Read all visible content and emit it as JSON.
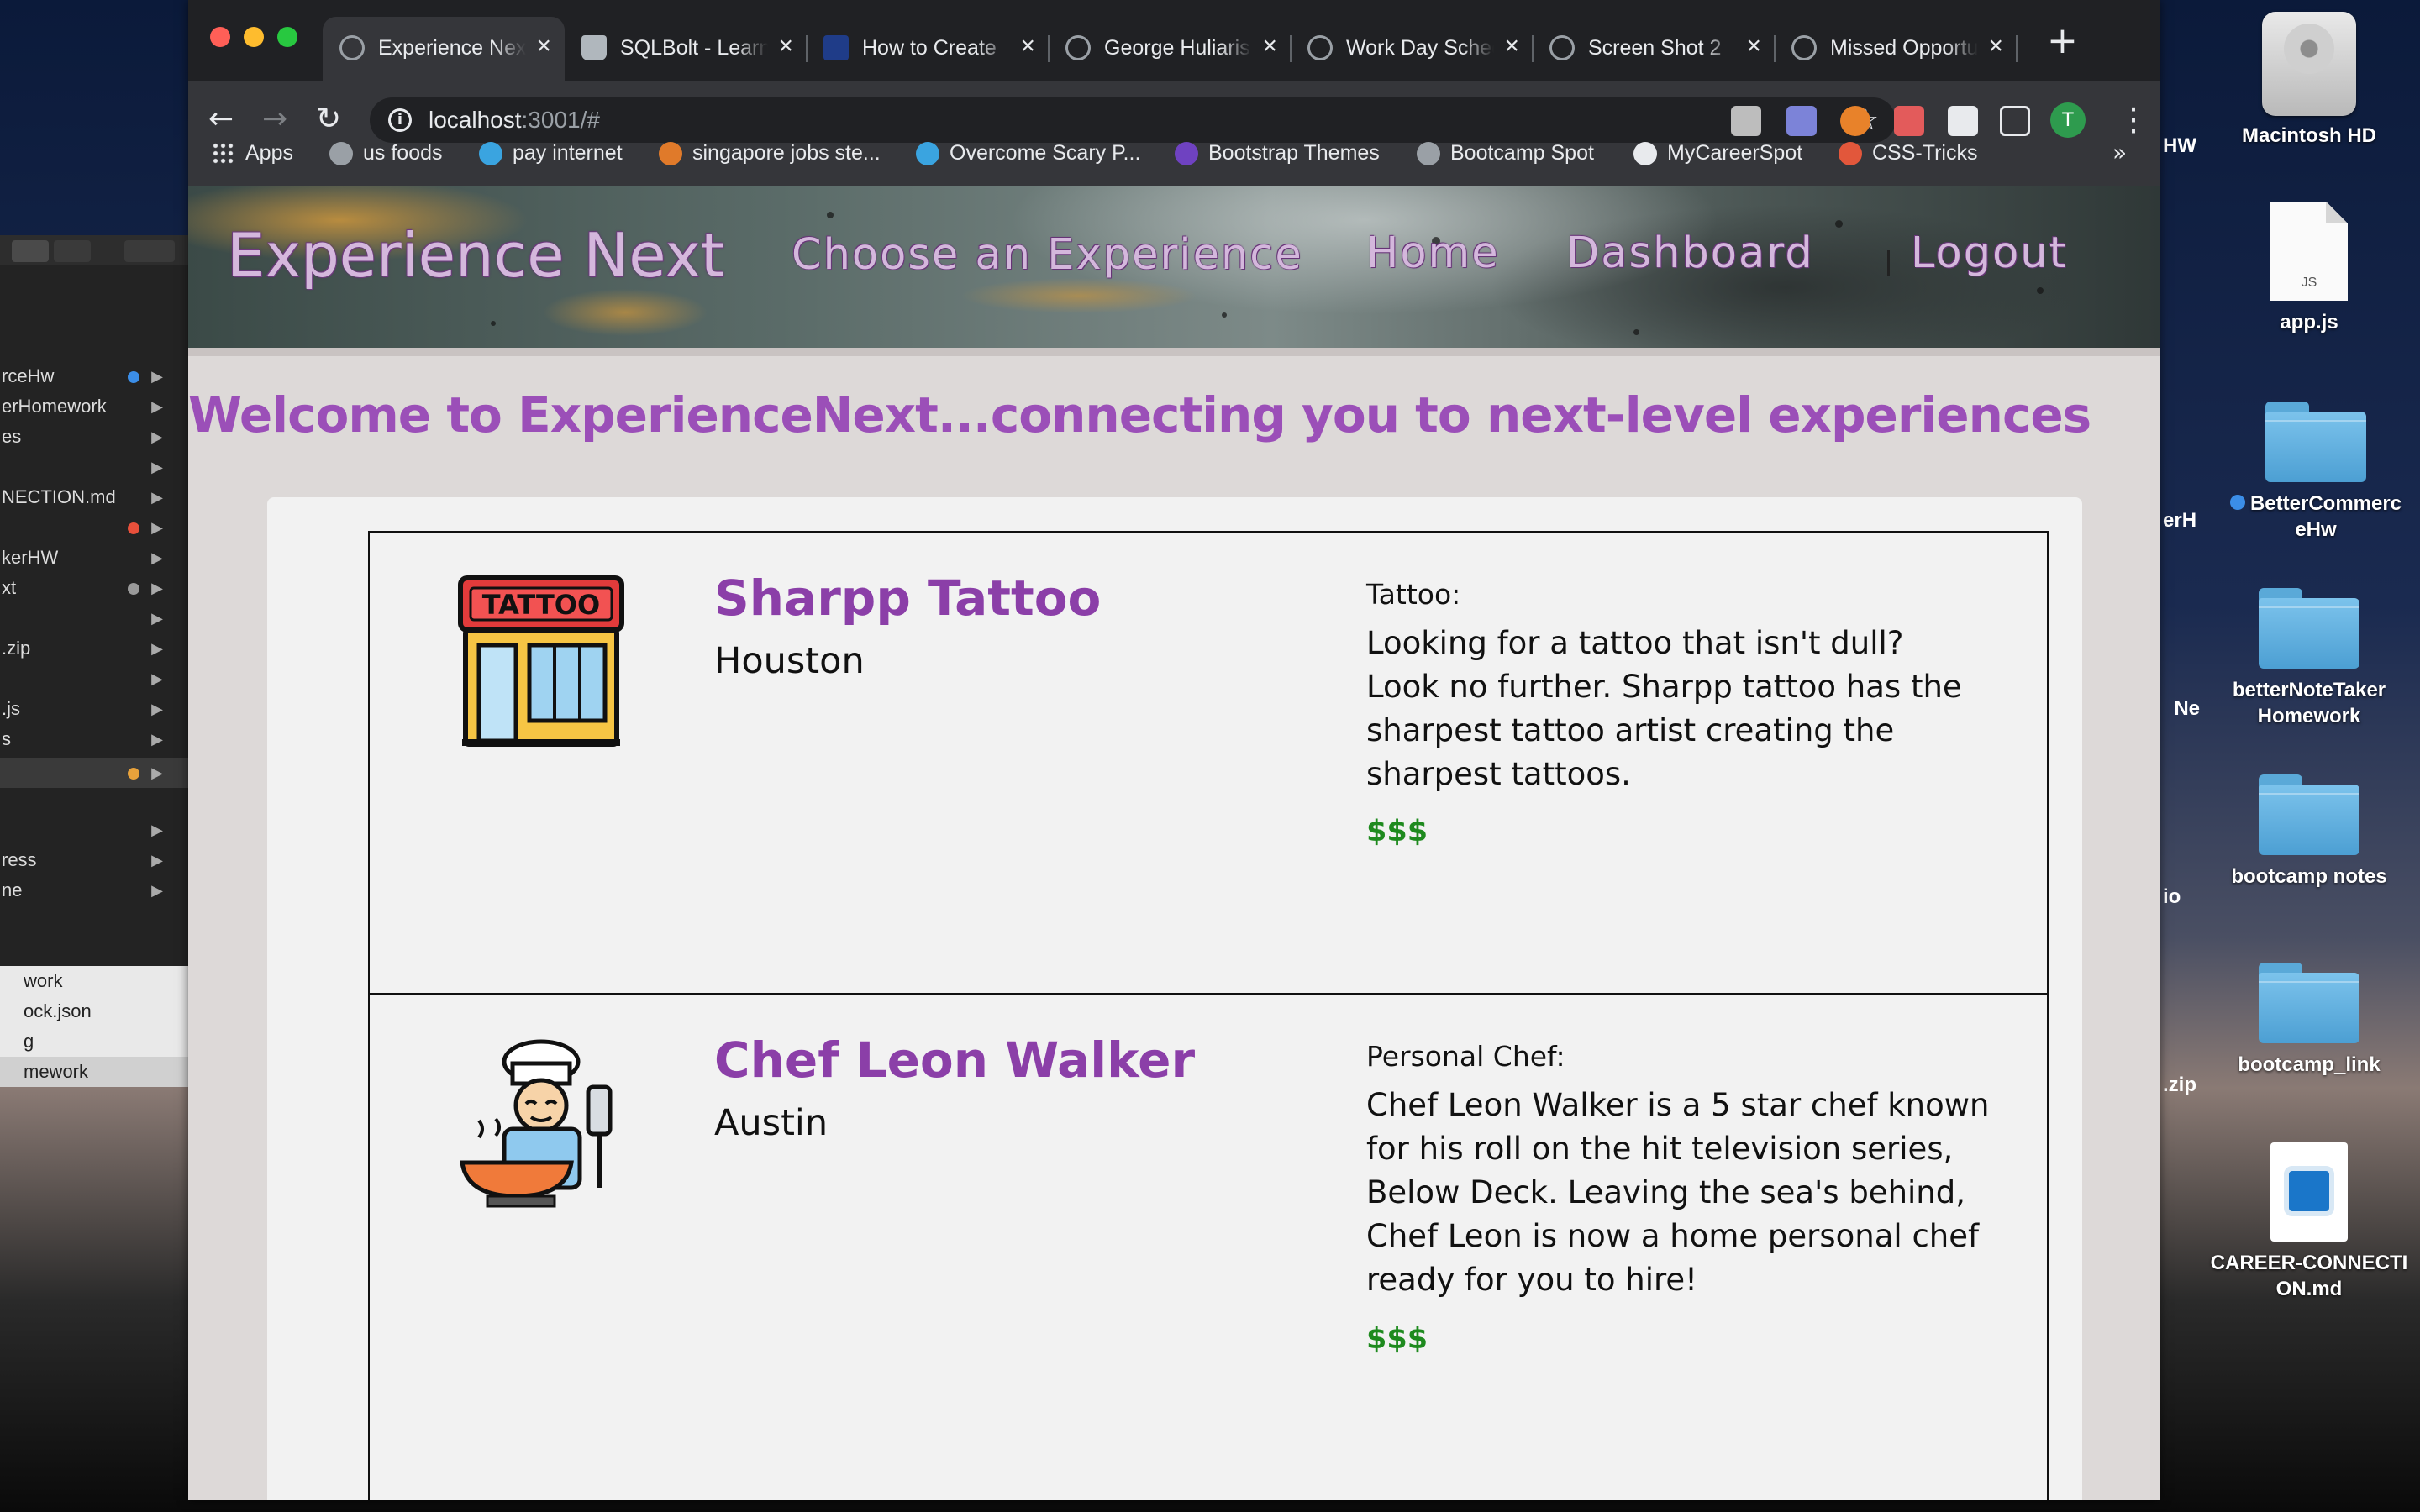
{
  "browser": {
    "tabs": [
      {
        "title": "Experience Next",
        "active": true
      },
      {
        "title": "SQLBolt - Learn SQL",
        "active": false
      },
      {
        "title": "How to Create",
        "active": false
      },
      {
        "title": "George Huliaris",
        "active": false
      },
      {
        "title": "Work Day Scheduler",
        "active": false
      },
      {
        "title": "Screen Shot 2",
        "active": false
      },
      {
        "title": "Missed Opportunities",
        "active": false
      }
    ],
    "url_host": "localhost",
    "url_rest": ":3001/#",
    "avatar_letter": "T",
    "bookmarks": [
      {
        "label": "Apps",
        "icon": "apps-grid-icon"
      },
      {
        "label": "us foods",
        "icon": "globe-icon"
      },
      {
        "label": "pay internet",
        "icon": "att-icon"
      },
      {
        "label": "singapore jobs ste...",
        "icon": "bookmark-icon"
      },
      {
        "label": "Overcome Scary P...",
        "icon": "m-icon"
      },
      {
        "label": "Bootstrap Themes",
        "icon": "bootstrap-icon"
      },
      {
        "label": "Bootcamp Spot",
        "icon": "globe-icon"
      },
      {
        "label": "MyCareerSpot",
        "icon": "cs-icon"
      },
      {
        "label": "CSS-Tricks",
        "icon": "asterisk-icon"
      }
    ],
    "bookmarks_more": "»"
  },
  "site": {
    "brand": "Experience Next",
    "nav": {
      "choose": "Choose an Experience",
      "home": "Home",
      "dashboard": "Dashboard",
      "logout": "Logout"
    },
    "welcome": "Welcome to ExperienceNext...connecting you to next-level experiences",
    "experiences": [
      {
        "name": "Sharpp Tattoo",
        "city": "Houston",
        "category": "Tattoo:",
        "description": "Looking for a tattoo that isn't dull? Look no further. Sharpp tattoo has the sharpest tattoo artist creating the sharpest tattoos.",
        "price": "$$$",
        "image_icon": "tattoo-shop-icon",
        "image_text": "TATTOO"
      },
      {
        "name": "Chef Leon Walker",
        "city": "Austin",
        "category": "Personal Chef:",
        "description": "Chef Leon Walker is a 5 star chef known for his roll on the hit television series, Below Deck. Leaving the sea's behind, Chef Leon is now a home personal chef ready for you to hire!",
        "price": "$$$",
        "image_icon": "chef-icon"
      }
    ]
  },
  "desktop": {
    "icons": [
      {
        "label": "Macintosh HD",
        "icon": "hard-drive-icon"
      },
      {
        "label": "app.js",
        "icon": "js-file-icon",
        "badge": "JS"
      },
      {
        "label": "BetterCommerceHw",
        "icon": "folder-icon"
      },
      {
        "label": "betterNoteTakerHomework",
        "icon": "folder-icon"
      },
      {
        "label": "bootcamp notes",
        "icon": "folder-icon"
      },
      {
        "label": "bootcamp_link",
        "icon": "folder-icon"
      },
      {
        "label": "CAREER-CONNECTION.md",
        "icon": "markdown-file-icon"
      }
    ],
    "peek_right": [
      "HW",
      "erH",
      "_Ne",
      "io",
      ".zip"
    ],
    "left_sidebar_rows": [
      "rceHw",
      "erHomework",
      "es",
      "",
      "NECTION.md",
      "",
      "kerHW",
      "xt",
      "",
      ".zip",
      "",
      ".js",
      "s",
      "",
      "",
      "",
      "ress",
      "ne"
    ],
    "left_finder_rows": [
      "work",
      "ock.json",
      "g",
      "mework"
    ]
  },
  "colors": {
    "brand_purple": "#9b4fb8",
    "price_green": "#1e8a1e",
    "chrome_dark": "#202124",
    "chrome_mid": "#35363a"
  }
}
